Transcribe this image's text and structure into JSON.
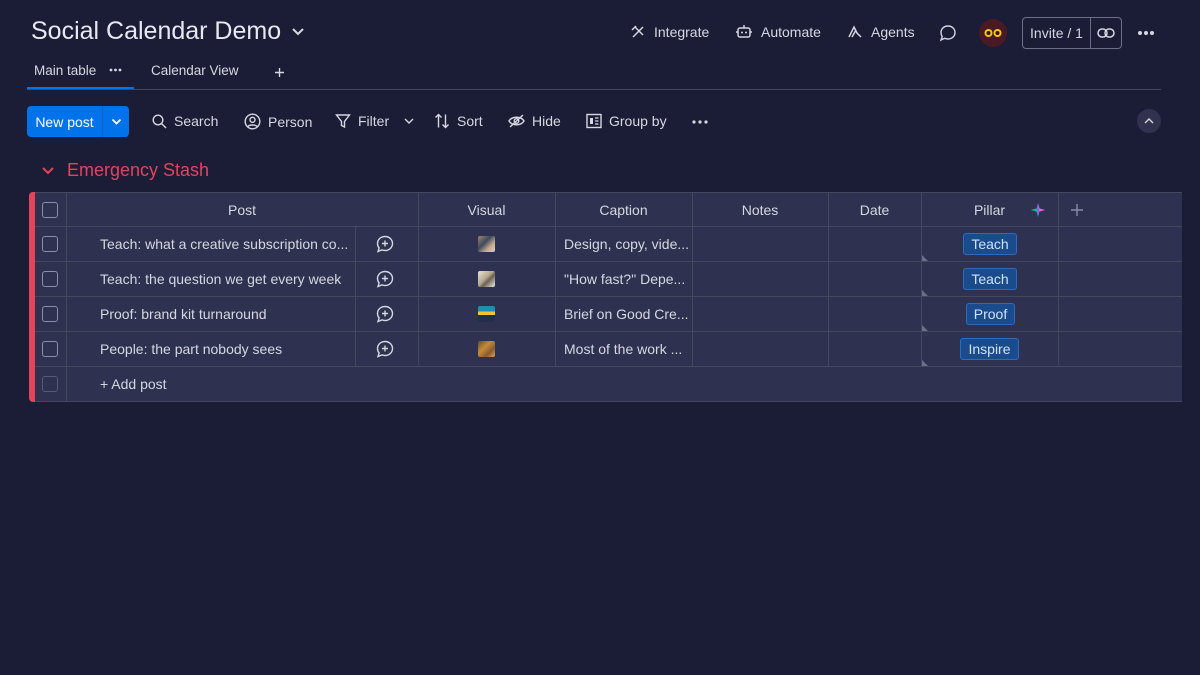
{
  "header": {
    "board_title": "Social Calendar Demo",
    "integrate": "Integrate",
    "automate": "Automate",
    "agents": "Agents",
    "invite": "Invite / 1"
  },
  "tabs": [
    {
      "label": "Main table",
      "active": true
    },
    {
      "label": "Calendar View",
      "active": false
    }
  ],
  "toolbar": {
    "new_post": "New post",
    "search": "Search",
    "person": "Person",
    "filter": "Filter",
    "sort": "Sort",
    "hide": "Hide",
    "group_by": "Group by"
  },
  "group": {
    "title": "Emergency Stash",
    "color": "#e2445c"
  },
  "columns": [
    "Post",
    "Visual",
    "Caption",
    "Notes",
    "Date",
    "Pillar"
  ],
  "rows": [
    {
      "post": "Teach: what a creative subscription co...",
      "caption": "Design, copy, vide...",
      "notes": "",
      "date": "",
      "pillar": "Teach"
    },
    {
      "post": "Teach: the question we get every week",
      "caption": "\"How fast?\" Depe...",
      "notes": "",
      "date": "",
      "pillar": "Teach"
    },
    {
      "post": "Proof: brand kit turnaround",
      "caption": "Brief on Good Cre...",
      "notes": "",
      "date": "",
      "pillar": "Proof"
    },
    {
      "post": "People: the part nobody sees",
      "caption": "Most of the work ...",
      "notes": "",
      "date": "",
      "pillar": "Inspire"
    }
  ],
  "add_post": "+ Add post",
  "colors": {
    "background": "#1b1d36",
    "table_bg": "#2e3150",
    "primary": "#0073ea",
    "pill_bg": "#1a4b8c"
  }
}
